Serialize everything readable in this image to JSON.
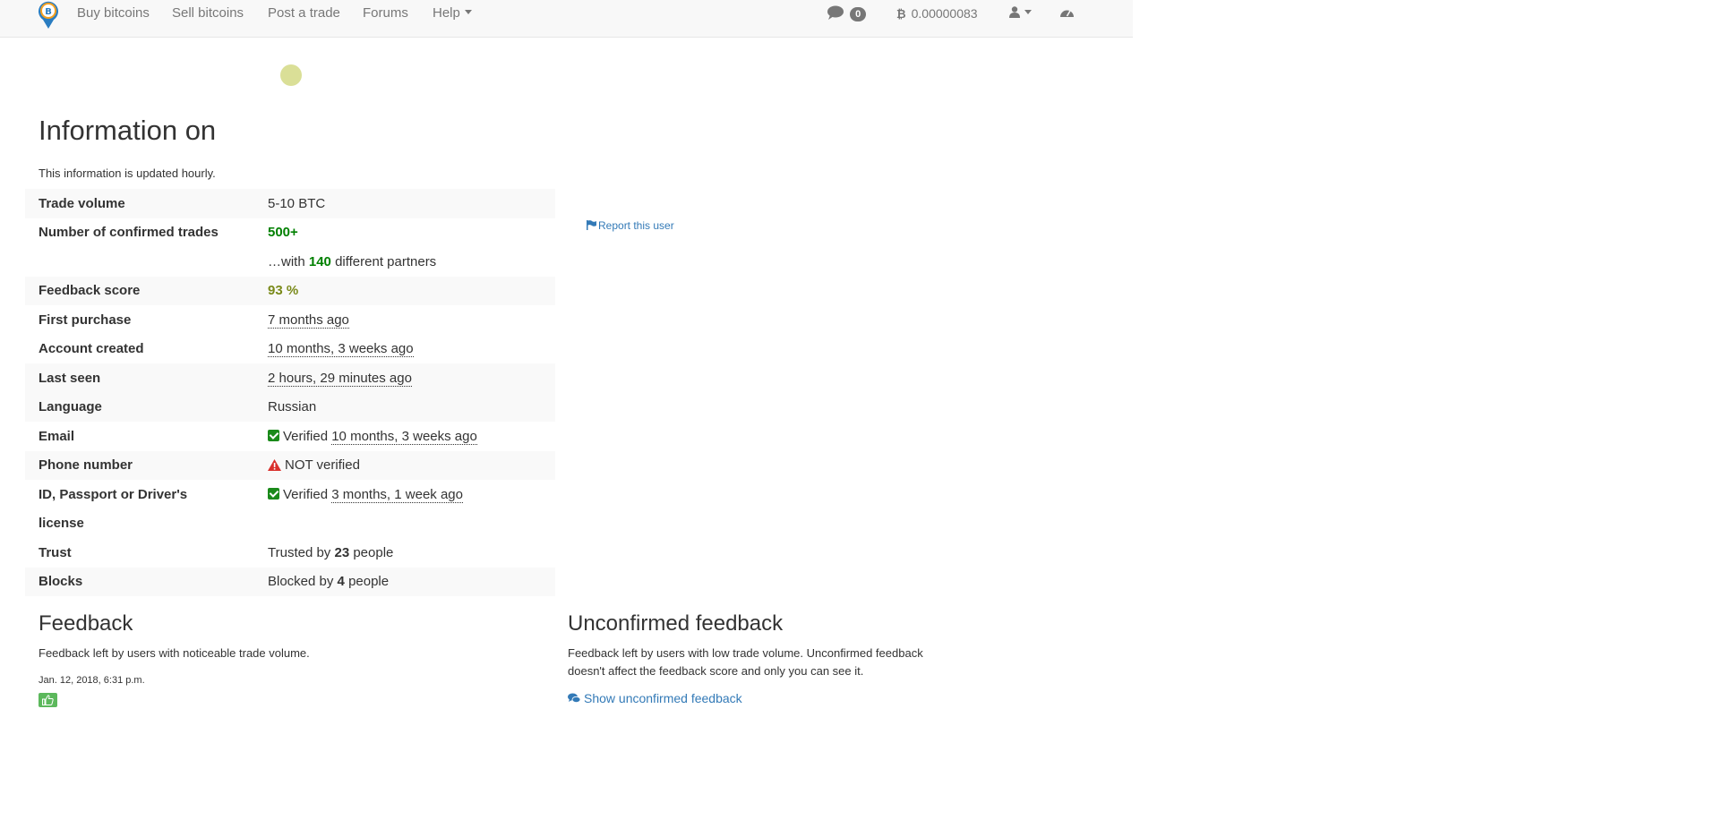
{
  "navbar": {
    "items": [
      "Buy bitcoins",
      "Sell bitcoins",
      "Post a trade",
      "Forums",
      "Help"
    ],
    "messages_count": "0",
    "balance": "0.00000083"
  },
  "page": {
    "title": "Information on",
    "updated_note": "This information is updated hourly."
  },
  "info": {
    "trade_volume_label": "Trade volume",
    "trade_volume_value": "5-10 BTC",
    "confirmed_trades_label": "Number of confirmed trades",
    "confirmed_trades_value": "500+",
    "partners_prefix": "…with",
    "partners_count": "140",
    "partners_suffix": "different partners",
    "feedback_score_label": "Feedback score",
    "feedback_score_value": "93 %",
    "first_purchase_label": "First purchase",
    "first_purchase_value": "7 months ago",
    "account_created_label": "Account created",
    "account_created_value": "10 months, 3 weeks ago",
    "last_seen_label": "Last seen",
    "last_seen_value": "2 hours, 29 minutes ago",
    "language_label": "Language",
    "language_value": "Russian",
    "email_label": "Email",
    "email_status": "Verified",
    "email_when": "10 months, 3 weeks ago",
    "phone_label": "Phone number",
    "phone_status": "NOT verified",
    "id_label_1": "ID, Passport or Driver's",
    "id_label_2": "license",
    "id_status": "Verified",
    "id_when": "3 months, 1 week ago",
    "trust_label": "Trust",
    "trust_prefix": "Trusted by",
    "trust_count": "23",
    "trust_suffix": "people",
    "blocks_label": "Blocks",
    "blocks_prefix": "Blocked by",
    "blocks_count": "4",
    "blocks_suffix": "people"
  },
  "report_link": "Report this user",
  "feedback": {
    "title": "Feedback",
    "desc": "Feedback left by users with noticeable trade volume.",
    "entries": [
      {
        "date": "Jan. 12, 2018, 6:31 p.m.",
        "type": "positive"
      }
    ]
  },
  "unconfirmed": {
    "title": "Unconfirmed feedback",
    "desc_1": "Feedback left by users with low trade volume. Unconfirmed feedback",
    "desc_2": "doesn't affect the feedback score and only you can see it.",
    "show_link": "Show unconfirmed feedback"
  },
  "colors": {
    "link": "#337ab7",
    "green": "#008000",
    "olive": "#7a8a1a",
    "navbar_bg": "#f8f8f8"
  },
  "icons": [
    "bitcoin-logo-icon",
    "comment-icon",
    "bitcoin-icon",
    "user-icon",
    "dashboard-icon",
    "flag-icon",
    "check-icon",
    "warning-icon",
    "thumbs-up-icon",
    "comments-icon"
  ]
}
